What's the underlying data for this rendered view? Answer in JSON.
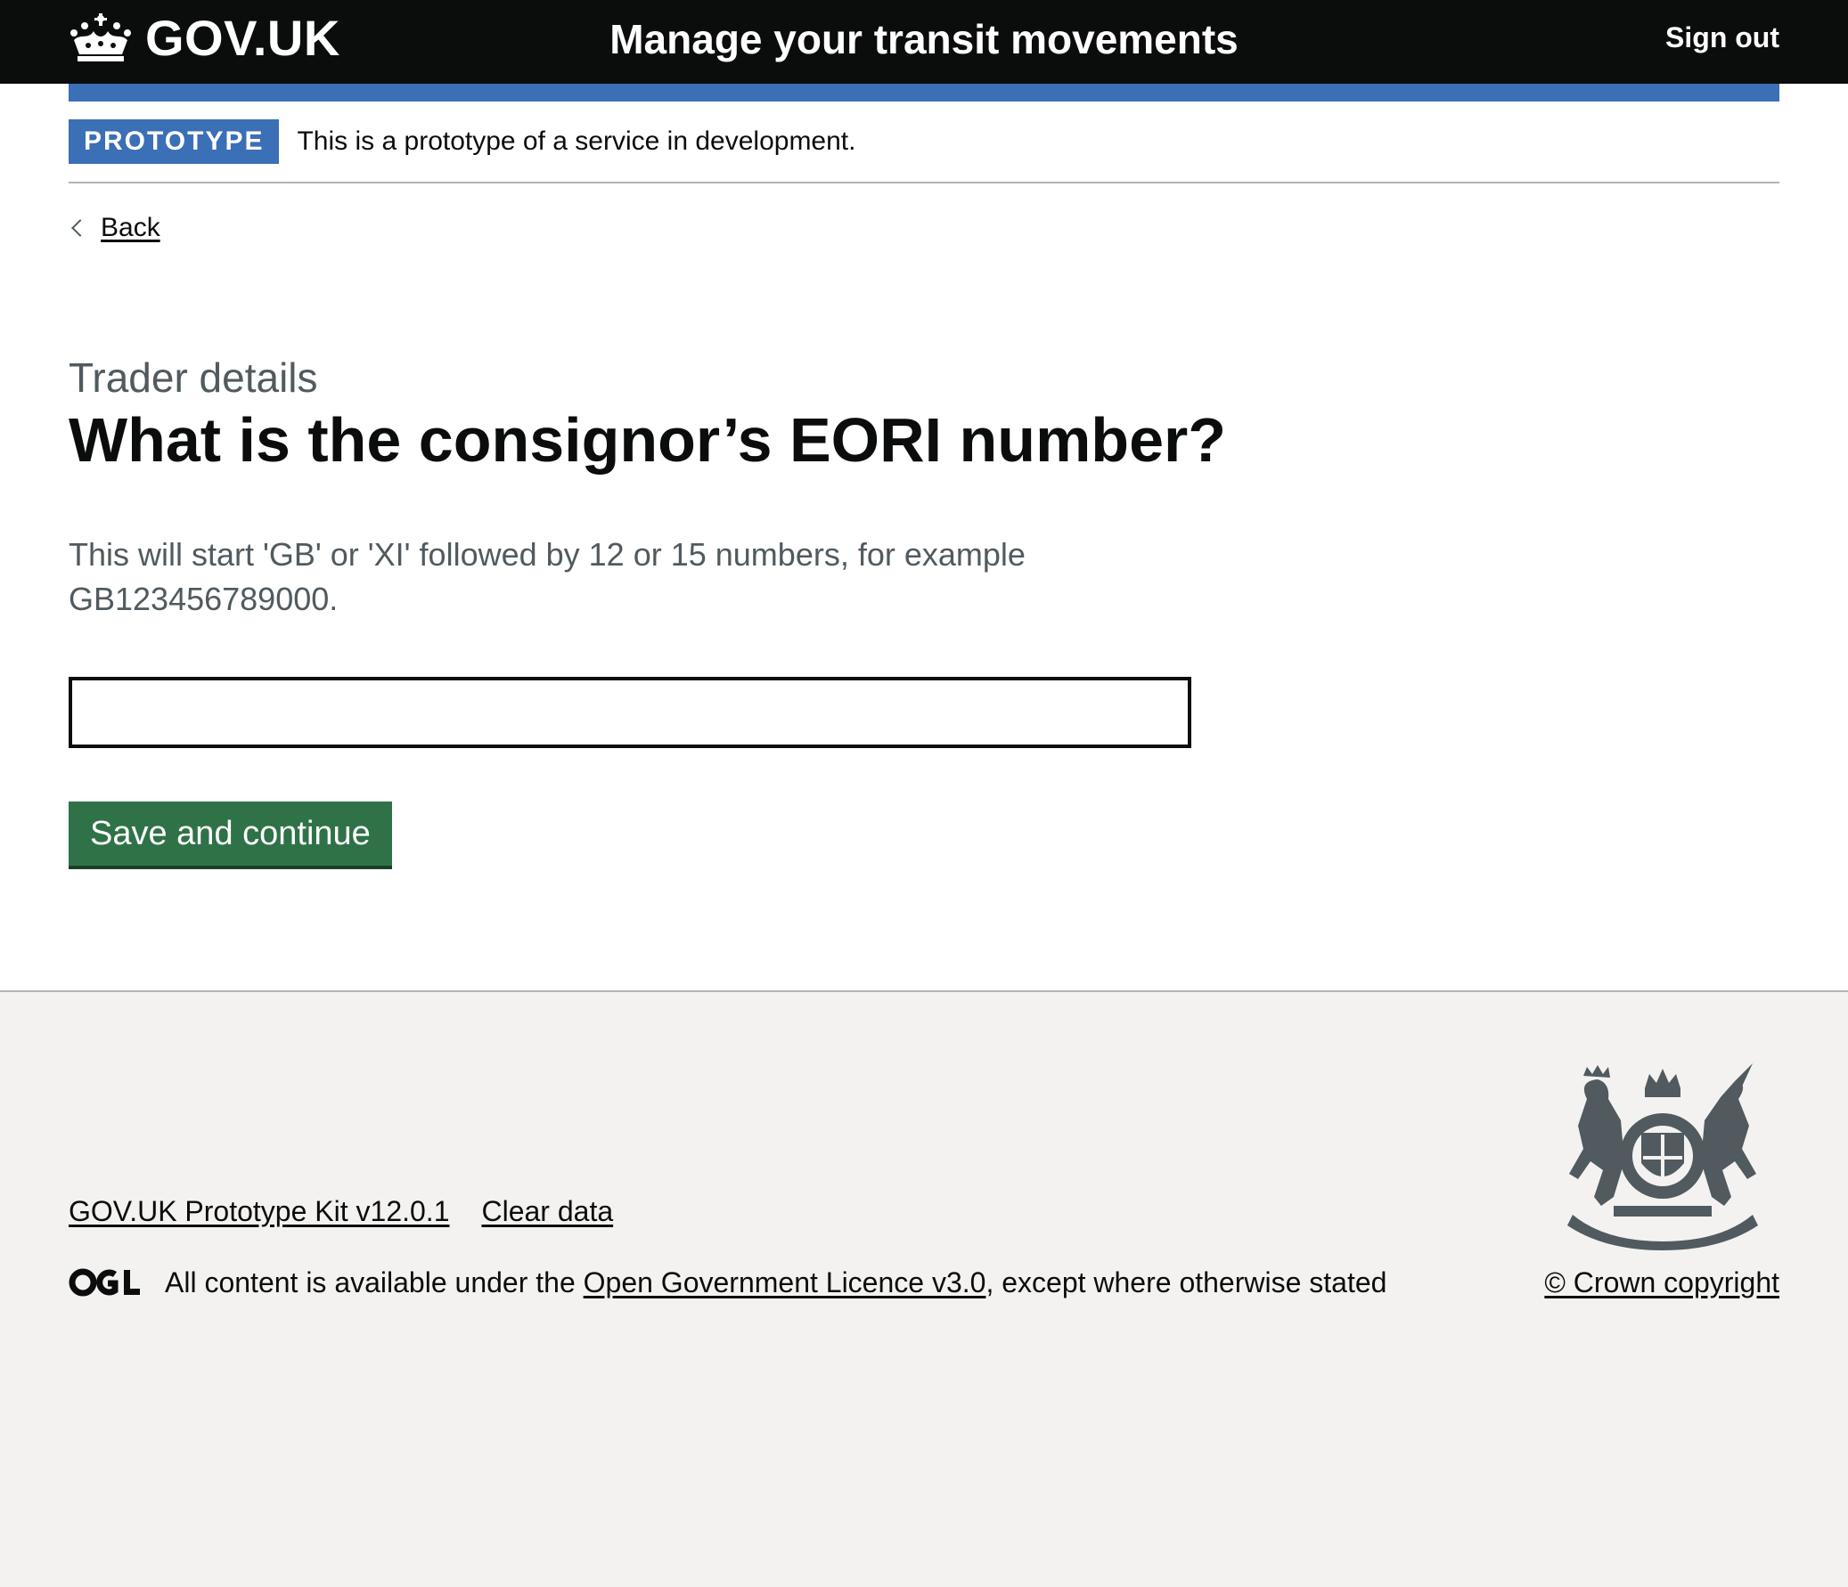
{
  "header": {
    "logo_text": "GOV.UK",
    "service_name": "Manage your transit movements",
    "sign_out": "Sign out"
  },
  "phase_banner": {
    "tag": "PROTOTYPE",
    "text": "This is a prototype of a service in development."
  },
  "back_link": "Back",
  "main": {
    "caption": "Trader details",
    "heading": "What is the consignor’s EORI number?",
    "hint": "This will start 'GB' or 'XI' followed by 12 or 15 numbers, for example GB123456789000.",
    "input_value": "",
    "button": "Save and continue"
  },
  "footer": {
    "links": [
      "GOV.UK Prototype Kit v12.0.1",
      "Clear data"
    ],
    "licence_prefix": "All content is available under the ",
    "licence_link": "Open Government Licence v3.0",
    "licence_suffix": ", except where otherwise stated",
    "copyright": "© Crown copyright"
  },
  "colors": {
    "header_bg": "#0b0c0c",
    "brand_blue": "#3b6fb6",
    "button_green": "#2f7247",
    "footer_bg": "#f3f2f1",
    "secondary_text": "#505a5f"
  },
  "icons": [
    "crown-icon",
    "chevron-left-icon",
    "ogl-logo",
    "royal-coat-of-arms"
  ]
}
